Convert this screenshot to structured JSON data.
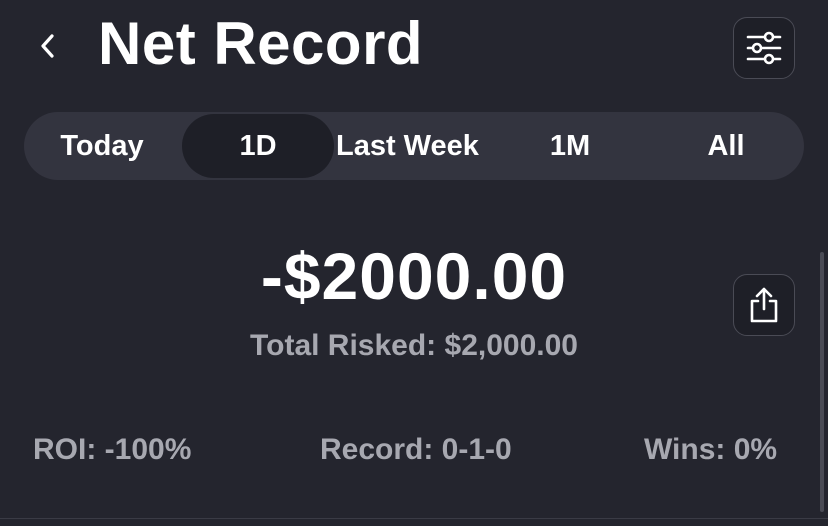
{
  "header": {
    "title": "Net Record",
    "back_icon": "chevron-left-icon",
    "filter_icon": "sliders-icon"
  },
  "tabs": [
    {
      "label": "Today",
      "active": false
    },
    {
      "label": "1D",
      "active": true
    },
    {
      "label": "Last Week",
      "active": false
    },
    {
      "label": "1M",
      "active": false
    },
    {
      "label": "All",
      "active": false
    }
  ],
  "summary": {
    "net_amount": "-$2000.00",
    "total_risked": "Total Risked: $2,000.00",
    "share_icon": "share-icon"
  },
  "stats": {
    "roi": "ROI: -100%",
    "record": "Record: 0-1-0",
    "wins": "Wins: 0%"
  },
  "colors": {
    "background": "#24252e",
    "segment_bg": "#33343f",
    "segment_active": "#1e1f27",
    "muted_text": "#a7a8b0"
  }
}
